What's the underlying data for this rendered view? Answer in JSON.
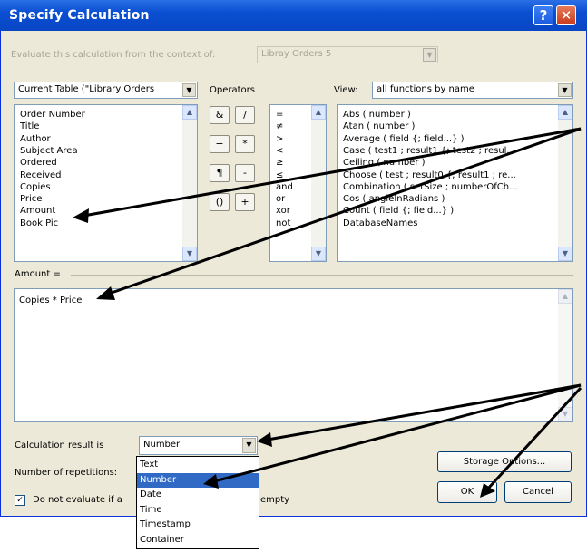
{
  "window": {
    "title": "Specify Calculation",
    "help_label": "?",
    "close_label": "✕"
  },
  "context": {
    "label": "Evaluate this calculation from the context of:",
    "value": "Libray Orders 5"
  },
  "table_select": {
    "value": "Current Table (\"Library Orders"
  },
  "operators": {
    "label": "Operators",
    "buttons": [
      "&",
      "/",
      "−",
      "*",
      "¶",
      "-",
      "()",
      "+"
    ],
    "list": [
      "=",
      "≠",
      ">",
      "<",
      "≥",
      "≤",
      "and",
      "or",
      "xor",
      "not"
    ]
  },
  "view": {
    "label": "View:",
    "value": "all functions by name"
  },
  "fields": [
    "Order Number",
    "Title",
    "Author",
    "Subject Area",
    "Ordered",
    "Received",
    "Copies",
    "Price",
    "Amount",
    "Book Pic"
  ],
  "functions": [
    "Abs ( number )",
    "Atan ( number )",
    "Average ( field {; field...} )",
    "Case ( test1 ; result1 {; test2 ; resul...",
    "Ceiling ( number )",
    "Choose ( test ; result0 {; result1 ; re...",
    "Combination ( setSize ; numberOfCh...",
    "Cos ( angleInRadians )",
    "Count ( field {; field...} )",
    "DatabaseNames"
  ],
  "formula": {
    "label": "Amount =",
    "value": "Copies * Price"
  },
  "result": {
    "label": "Calculation result is",
    "value": "Number",
    "options": [
      "Text",
      "Number",
      "Date",
      "Time",
      "Timestamp",
      "Container"
    ],
    "selected_index": 1
  },
  "repetitions": {
    "label": "Number of repetitions:"
  },
  "dont_evaluate": {
    "label_left": "Do not evaluate if a",
    "label_right": "empty",
    "checked": true,
    "check_mark": "✓"
  },
  "buttons": {
    "storage": "Storage Options...",
    "ok": "OK",
    "cancel": "Cancel"
  },
  "glyphs": {
    "up": "▲",
    "down": "▼"
  }
}
